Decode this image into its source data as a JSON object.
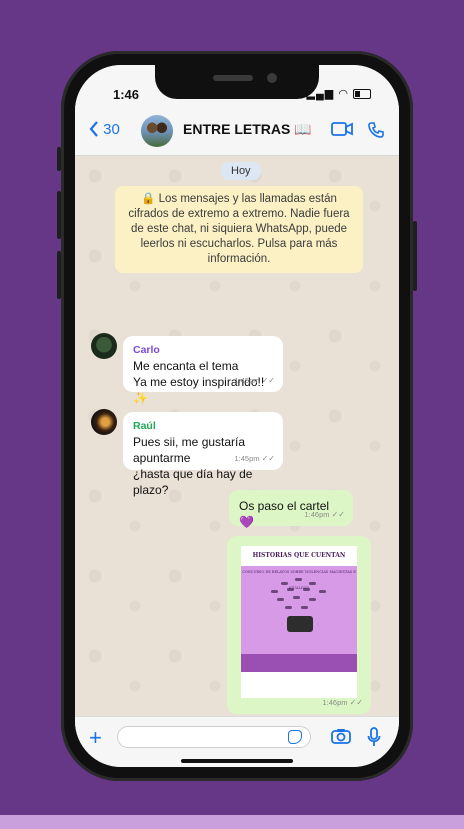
{
  "status_bar": {
    "time": "1:46"
  },
  "header": {
    "back_count": "30",
    "group_name": "ENTRE LETRAS 📖",
    "icons": [
      "back-chevron-icon",
      "video-call-icon",
      "phone-call-icon"
    ]
  },
  "chat": {
    "day_label": "Hoy",
    "system_message": "🔒 Los mensajes y las llamadas están cifrados de extremo a extremo. Nadie fuera de este chat, ni siquiera WhatsApp, puede leerlos ni escucharlos. Pulsa para más información.",
    "messages": [
      {
        "sender": "Carlo",
        "sender_color": "#7b4bd6",
        "line1": "Me encanta el tema",
        "line2": "Ya me estoy inspirando!! ✨",
        "time": "1:45pm"
      },
      {
        "sender": "Raúl",
        "sender_color": "#1fa855",
        "line1": "Pues sii, me gustaría apuntarme",
        "line2": "¿hasta que día hay de plazo?",
        "time": "1:45pm"
      },
      {
        "text": "Os paso el cartel 💜",
        "time": "1:46pm"
      },
      {
        "image": "poster",
        "poster_title": "HISTORIAS QUE CUENTAN",
        "poster_subtitle": "CONCURSO DE RELATOS SOBRE VIOLENCIAS MACHISTAS E IGUALDAD",
        "time": "1:46pm"
      }
    ]
  },
  "colors": {
    "background": "#673787",
    "accent": "#1a73e8",
    "outgoing_bubble": "#dcf7c5",
    "system_bubble": "#fbf1c4"
  }
}
